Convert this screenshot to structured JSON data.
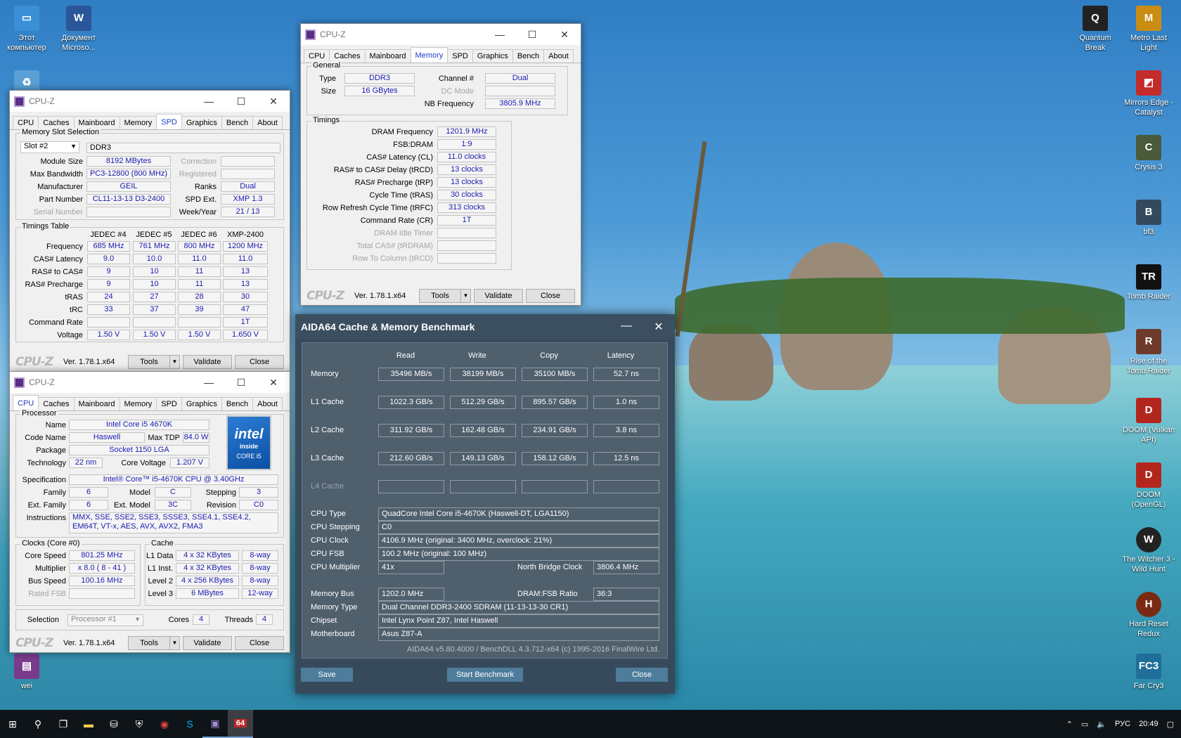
{
  "desktop": {
    "left_icons": [
      {
        "label": "Этот компьютер",
        "icon": "computer-icon"
      },
      {
        "label": "Документ Microso...",
        "icon": "word-icon"
      },
      {
        "label": "wei",
        "icon": "winrar-icon"
      }
    ],
    "right_icons": [
      {
        "label": "Quantum Break",
        "icon": "game-icon"
      },
      {
        "label": "Metro Last Light",
        "icon": "game-icon"
      },
      {
        "label": "Mirrors Edge - Catalyst",
        "icon": "game-icon"
      },
      {
        "label": "Crysis 3",
        "icon": "game-icon"
      },
      {
        "label": "bf3",
        "icon": "game-icon"
      },
      {
        "label": "Tomb Raider",
        "icon": "game-icon"
      },
      {
        "label": "Rise of the Tomb Raider",
        "icon": "game-icon"
      },
      {
        "label": "DOOM (Vulkan API)",
        "icon": "game-icon"
      },
      {
        "label": "DOOM (OpenGL)",
        "icon": "game-icon"
      },
      {
        "label": "The Witcher 3 - Wild Hunt",
        "icon": "game-icon"
      },
      {
        "label": "Hard Reset Redux",
        "icon": "game-icon"
      },
      {
        "label": "Far Cry3",
        "icon": "game-icon"
      }
    ]
  },
  "cpuz_common": {
    "title": "CPU-Z",
    "logo": "CPU-Z",
    "version": "Ver. 1.78.1.x64",
    "tools": "Tools",
    "validate": "Validate",
    "close": "Close",
    "tabs": [
      "CPU",
      "Caches",
      "Mainboard",
      "Memory",
      "SPD",
      "Graphics",
      "Bench",
      "About"
    ]
  },
  "spd": {
    "group_slot": "Memory Slot Selection",
    "slot": "Slot #2",
    "type": "DDR3",
    "rows_left": [
      {
        "label": "Module Size",
        "value": "8192 MBytes"
      },
      {
        "label": "Max Bandwidth",
        "value": "PC3-12800 (800 MHz)"
      },
      {
        "label": "Manufacturer",
        "value": "GEIL"
      },
      {
        "label": "Part Number",
        "value": "CL11-13-13 D3-2400"
      },
      {
        "label": "Serial Number",
        "value": ""
      }
    ],
    "rows_right": [
      {
        "label": "Correction",
        "value": ""
      },
      {
        "label": "Registered",
        "value": ""
      },
      {
        "label": "Ranks",
        "value": "Dual"
      },
      {
        "label": "SPD Ext.",
        "value": "XMP 1.3"
      },
      {
        "label": "Week/Year",
        "value": "21 / 13"
      }
    ],
    "group_timings": "Timings Table",
    "cols": [
      "JEDEC #4",
      "JEDEC #5",
      "JEDEC #6",
      "XMP-2400"
    ],
    "timing_rows": [
      {
        "label": "Frequency",
        "values": [
          "685 MHz",
          "761 MHz",
          "800 MHz",
          "1200 MHz"
        ]
      },
      {
        "label": "CAS# Latency",
        "values": [
          "9.0",
          "10.0",
          "11.0",
          "11.0"
        ]
      },
      {
        "label": "RAS# to CAS#",
        "values": [
          "9",
          "10",
          "11",
          "13"
        ]
      },
      {
        "label": "RAS# Precharge",
        "values": [
          "9",
          "10",
          "11",
          "13"
        ]
      },
      {
        "label": "tRAS",
        "values": [
          "24",
          "27",
          "28",
          "30"
        ]
      },
      {
        "label": "tRC",
        "values": [
          "33",
          "37",
          "39",
          "47"
        ]
      },
      {
        "label": "Command Rate",
        "values": [
          "",
          "",
          "",
          "1T"
        ]
      },
      {
        "label": "Voltage",
        "values": [
          "1.50 V",
          "1.50 V",
          "1.50 V",
          "1.650 V"
        ]
      }
    ]
  },
  "cpu": {
    "group_processor": "Processor",
    "name_label": "Name",
    "name": "Intel Core i5 4670K",
    "codename_label": "Code Name",
    "codename": "Haswell",
    "maxtdp_label": "Max TDP",
    "maxtdp": "84.0 W",
    "package_label": "Package",
    "package": "Socket 1150 LGA",
    "tech_label": "Technology",
    "tech": "22 nm",
    "corev_label": "Core Voltage",
    "corev": "1.207 V",
    "spec_label": "Specification",
    "spec": "Intel® Core™ i5-4670K CPU @ 3.40GHz",
    "family_label": "Family",
    "family": "6",
    "model_label": "Model",
    "model": "C",
    "stepping_label": "Stepping",
    "stepping": "3",
    "extfamily_label": "Ext. Family",
    "extfamily": "6",
    "extmodel_label": "Ext. Model",
    "extmodel": "3C",
    "revision_label": "Revision",
    "revision": "C0",
    "instr_label": "Instructions",
    "instr": "MMX, SSE, SSE2, SSE3, SSSE3, SSE4.1, SSE4.2, EM64T, VT-x, AES, AVX, AVX2, FMA3",
    "intel_logo": [
      "intel",
      "inside",
      "CORE i5"
    ],
    "group_clocks": "Clocks (Core #0)",
    "corespeed_label": "Core Speed",
    "corespeed": "801.25 MHz",
    "mult_label": "Multiplier",
    "mult": "x 8.0 ( 8 - 41 )",
    "bus_label": "Bus Speed",
    "bus": "100.16 MHz",
    "ratedfsb_label": "Rated FSB",
    "ratedfsb": "",
    "group_cache": "Cache",
    "cache": [
      {
        "label": "L1 Data",
        "size": "4 x 32 KBytes",
        "way": "8-way"
      },
      {
        "label": "L1 Inst.",
        "size": "4 x 32 KBytes",
        "way": "8-way"
      },
      {
        "label": "Level 2",
        "size": "4 x 256 KBytes",
        "way": "8-way"
      },
      {
        "label": "Level 3",
        "size": "6 MBytes",
        "way": "12-way"
      }
    ],
    "selection_label": "Selection",
    "selection": "Processor #1",
    "cores_label": "Cores",
    "cores": "4",
    "threads_label": "Threads",
    "threads": "4"
  },
  "mem": {
    "group_general": "General",
    "type_label": "Type",
    "type": "DDR3",
    "size_label": "Size",
    "size": "16 GBytes",
    "channel_label": "Channel #",
    "channel": "Dual",
    "dcmode_label": "DC Mode",
    "dcmode": "",
    "nbfreq_label": "NB Frequency",
    "nbfreq": "3805.9 MHz",
    "group_timings": "Timings",
    "rows": [
      {
        "label": "DRAM Frequency",
        "value": "1201.9 MHz",
        "dim": false
      },
      {
        "label": "FSB:DRAM",
        "value": "1:9",
        "dim": false
      },
      {
        "label": "CAS# Latency (CL)",
        "value": "11.0 clocks",
        "dim": false
      },
      {
        "label": "RAS# to CAS# Delay (tRCD)",
        "value": "13 clocks",
        "dim": false
      },
      {
        "label": "RAS# Precharge (tRP)",
        "value": "13 clocks",
        "dim": false
      },
      {
        "label": "Cycle Time (tRAS)",
        "value": "30 clocks",
        "dim": false
      },
      {
        "label": "Row Refresh Cycle Time (tRFC)",
        "value": "313 clocks",
        "dim": false
      },
      {
        "label": "Command Rate (CR)",
        "value": "1T",
        "dim": false
      },
      {
        "label": "DRAM Idle Timer",
        "value": "",
        "dim": true
      },
      {
        "label": "Total CAS# (tRDRAM)",
        "value": "",
        "dim": true
      },
      {
        "label": "Row To Column (tRCD)",
        "value": "",
        "dim": true
      }
    ]
  },
  "aida": {
    "title": "AIDA64 Cache & Memory Benchmark",
    "cols": [
      "Read",
      "Write",
      "Copy",
      "Latency"
    ],
    "bench_rows": [
      {
        "label": "Memory",
        "values": [
          "35496 MB/s",
          "38199 MB/s",
          "35100 MB/s",
          "52.7 ns"
        ],
        "dim": false
      },
      {
        "label": "L1 Cache",
        "values": [
          "1022.3 GB/s",
          "512.29 GB/s",
          "895.57 GB/s",
          "1.0 ns"
        ],
        "dim": false
      },
      {
        "label": "L2 Cache",
        "values": [
          "311.92 GB/s",
          "162.48 GB/s",
          "234.91 GB/s",
          "3.8 ns"
        ],
        "dim": false
      },
      {
        "label": "L3 Cache",
        "values": [
          "212.60 GB/s",
          "149.13 GB/s",
          "158.12 GB/s",
          "12.5 ns"
        ],
        "dim": false
      },
      {
        "label": "L4 Cache",
        "values": [
          "",
          "",
          "",
          ""
        ],
        "dim": true
      }
    ],
    "cpu_type_label": "CPU Type",
    "cpu_type": "QuadCore Intel Core i5-4670K  (Haswell-DT, LGA1150)",
    "cpu_stepping_label": "CPU Stepping",
    "cpu_stepping": "C0",
    "cpu_clock_label": "CPU Clock",
    "cpu_clock": "4106.9 MHz  (original: 3400 MHz, overclock: 21%)",
    "cpu_fsb_label": "CPU FSB",
    "cpu_fsb": "100.2 MHz  (original: 100 MHz)",
    "cpu_mult_label": "CPU Multiplier",
    "cpu_mult": "41x",
    "nb_clock_label": "North Bridge Clock",
    "nb_clock": "3806.4 MHz",
    "mem_bus_label": "Memory Bus",
    "mem_bus": "1202.0 MHz",
    "dram_fsb_label": "DRAM:FSB Ratio",
    "dram_fsb": "36:3",
    "mem_type_label": "Memory Type",
    "mem_type": "Dual Channel DDR3-2400 SDRAM  (11-13-13-30 CR1)",
    "chipset_label": "Chipset",
    "chipset": "Intel Lynx Point Z87, Intel Haswell",
    "mobo_label": "Motherboard",
    "mobo": "Asus Z87-A",
    "footer": "AIDA64 v5.80.4000 / BenchDLL 4.3.712-x64  (c) 1995-2016 FinalWire Ltd.",
    "save": "Save",
    "start": "Start Benchmark",
    "close": "Close"
  },
  "taskbar": {
    "lang": "РУС",
    "time": "20:49"
  }
}
